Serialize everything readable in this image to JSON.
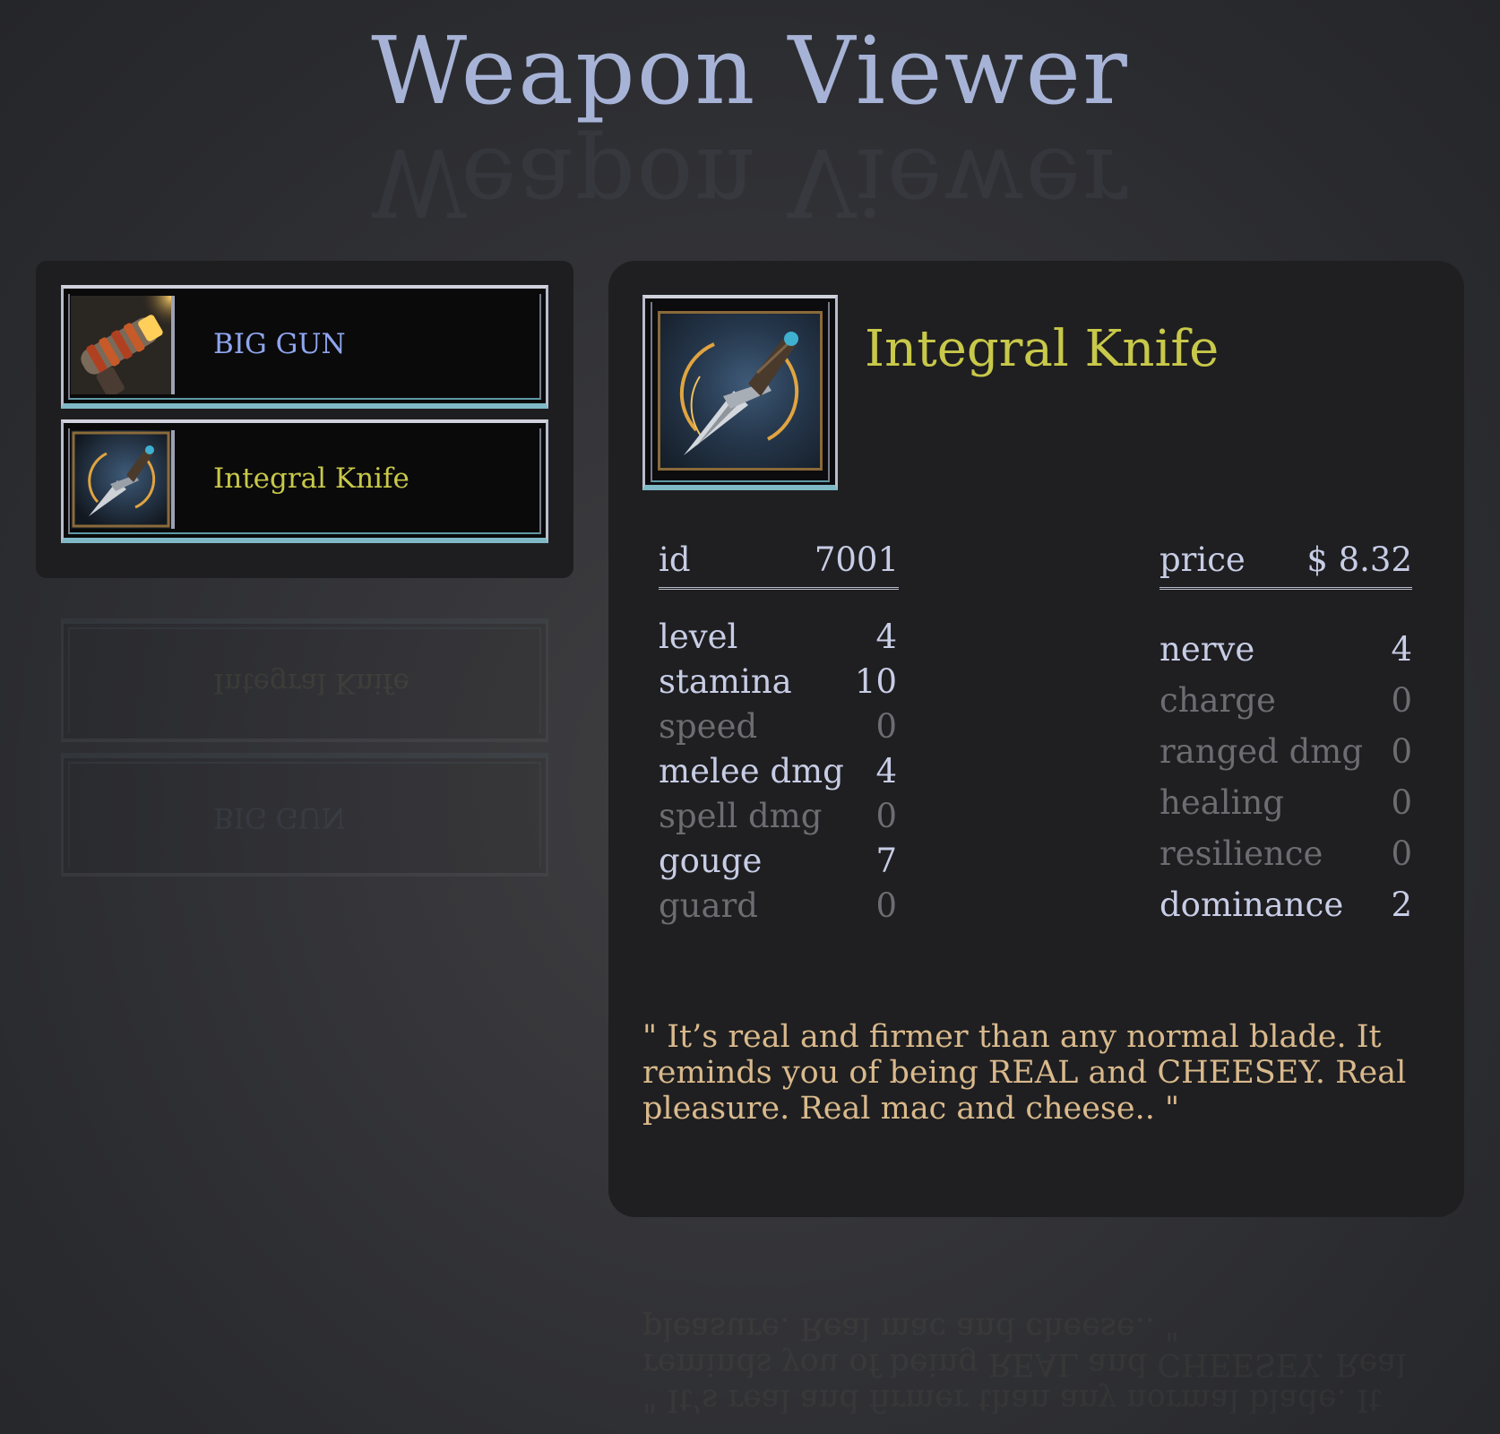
{
  "app": {
    "title": "Weapon Viewer"
  },
  "weapons": [
    {
      "name": "BIG GUN",
      "icon": "ray-gun-icon",
      "label_color": "#8fa6ee"
    },
    {
      "name": "Integral Knife",
      "icon": "dagger-icon",
      "label_color": "#c8c84a"
    }
  ],
  "detail": {
    "name": "Integral Knife",
    "icon": "dagger-icon",
    "id_label": "id",
    "id_value": "7001",
    "price_label": "price",
    "price_value": "$ 8.32",
    "left_stats": [
      {
        "label": "level",
        "value": "4",
        "active": true
      },
      {
        "label": "stamina",
        "value": "10",
        "active": true
      },
      {
        "label": "speed",
        "value": "0",
        "active": false
      },
      {
        "label": "melee dmg",
        "value": "4",
        "active": true
      },
      {
        "label": "spell dmg",
        "value": "0",
        "active": false
      },
      {
        "label": "gouge",
        "value": "7",
        "active": true
      },
      {
        "label": "guard",
        "value": "0",
        "active": false
      }
    ],
    "right_stats": [
      {
        "label": "nerve",
        "value": "4",
        "active": true
      },
      {
        "label": "charge",
        "value": "0",
        "active": false
      },
      {
        "label": "ranged dmg",
        "value": "0",
        "active": false
      },
      {
        "label": "healing",
        "value": "0",
        "active": false
      },
      {
        "label": "resilience",
        "value": "0",
        "active": false
      },
      {
        "label": "dominance",
        "value": "2",
        "active": true
      }
    ],
    "description": "\" It’s real and firmer than any normal blade. It reminds you of being REAL and CHEESEY. Real pleasure. Real mac and cheese.. \""
  },
  "colors": {
    "title": "#a7b3d6",
    "selected_name": "#c8c84a",
    "stat_active": "#c8cde6",
    "stat_inactive": "#6c6c72",
    "description": "#d9b98c"
  }
}
